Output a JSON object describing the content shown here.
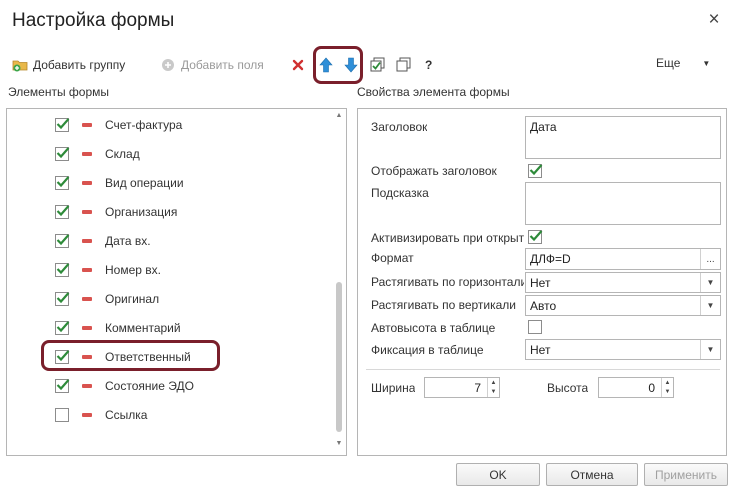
{
  "dialog": {
    "title": "Настройка формы"
  },
  "toolbar": {
    "add_group": "Добавить группу",
    "add_fields": "Добавить поля",
    "help": "?",
    "more": "Еще"
  },
  "sections": {
    "left": "Элементы формы",
    "right": "Свойства элемента формы"
  },
  "elements": [
    {
      "label": "Счет-фактура",
      "checked": true
    },
    {
      "label": "Склад",
      "checked": true
    },
    {
      "label": "Вид операции",
      "checked": true
    },
    {
      "label": "Организация",
      "checked": true
    },
    {
      "label": "Дата вх.",
      "checked": true
    },
    {
      "label": "Номер вх.",
      "checked": true
    },
    {
      "label": "Оригинал",
      "checked": true
    },
    {
      "label": "Комментарий",
      "checked": true
    },
    {
      "label": "Ответственный",
      "checked": true
    },
    {
      "label": "Состояние ЭДО",
      "checked": true
    },
    {
      "label": "Ссылка",
      "checked": false
    }
  ],
  "properties": {
    "header_label": "Заголовок",
    "header_value": "Дата",
    "show_header_label": "Отображать заголовок",
    "show_header_checked": true,
    "hint_label": "Подсказка",
    "hint_value": "",
    "activate_label": "Активизировать при открытии",
    "activate_checked": true,
    "format_label": "Формат",
    "format_value": "ДЛФ=D",
    "format_dots": "...",
    "stretch_h_label": "Растягивать по горизонтали",
    "stretch_h_value": "Нет",
    "stretch_v_label": "Растягивать по вертикали",
    "stretch_v_value": "Авто",
    "autoheight_label": "Автовысота в таблице",
    "autoheight_checked": false,
    "fix_label": "Фиксация в таблице",
    "fix_value": "Нет",
    "width_label": "Ширина",
    "width_value": "7",
    "height_label": "Высота",
    "height_value": "0"
  },
  "buttons": {
    "ok": "OK",
    "cancel": "Отмена",
    "apply": "Применить"
  },
  "colors": {
    "highlight": "#7a1f2b",
    "check_green": "#2e8b3a",
    "minus_red": "#d9534f",
    "arrow_blue": "#2f8fd8",
    "delete_red": "#d03030"
  }
}
